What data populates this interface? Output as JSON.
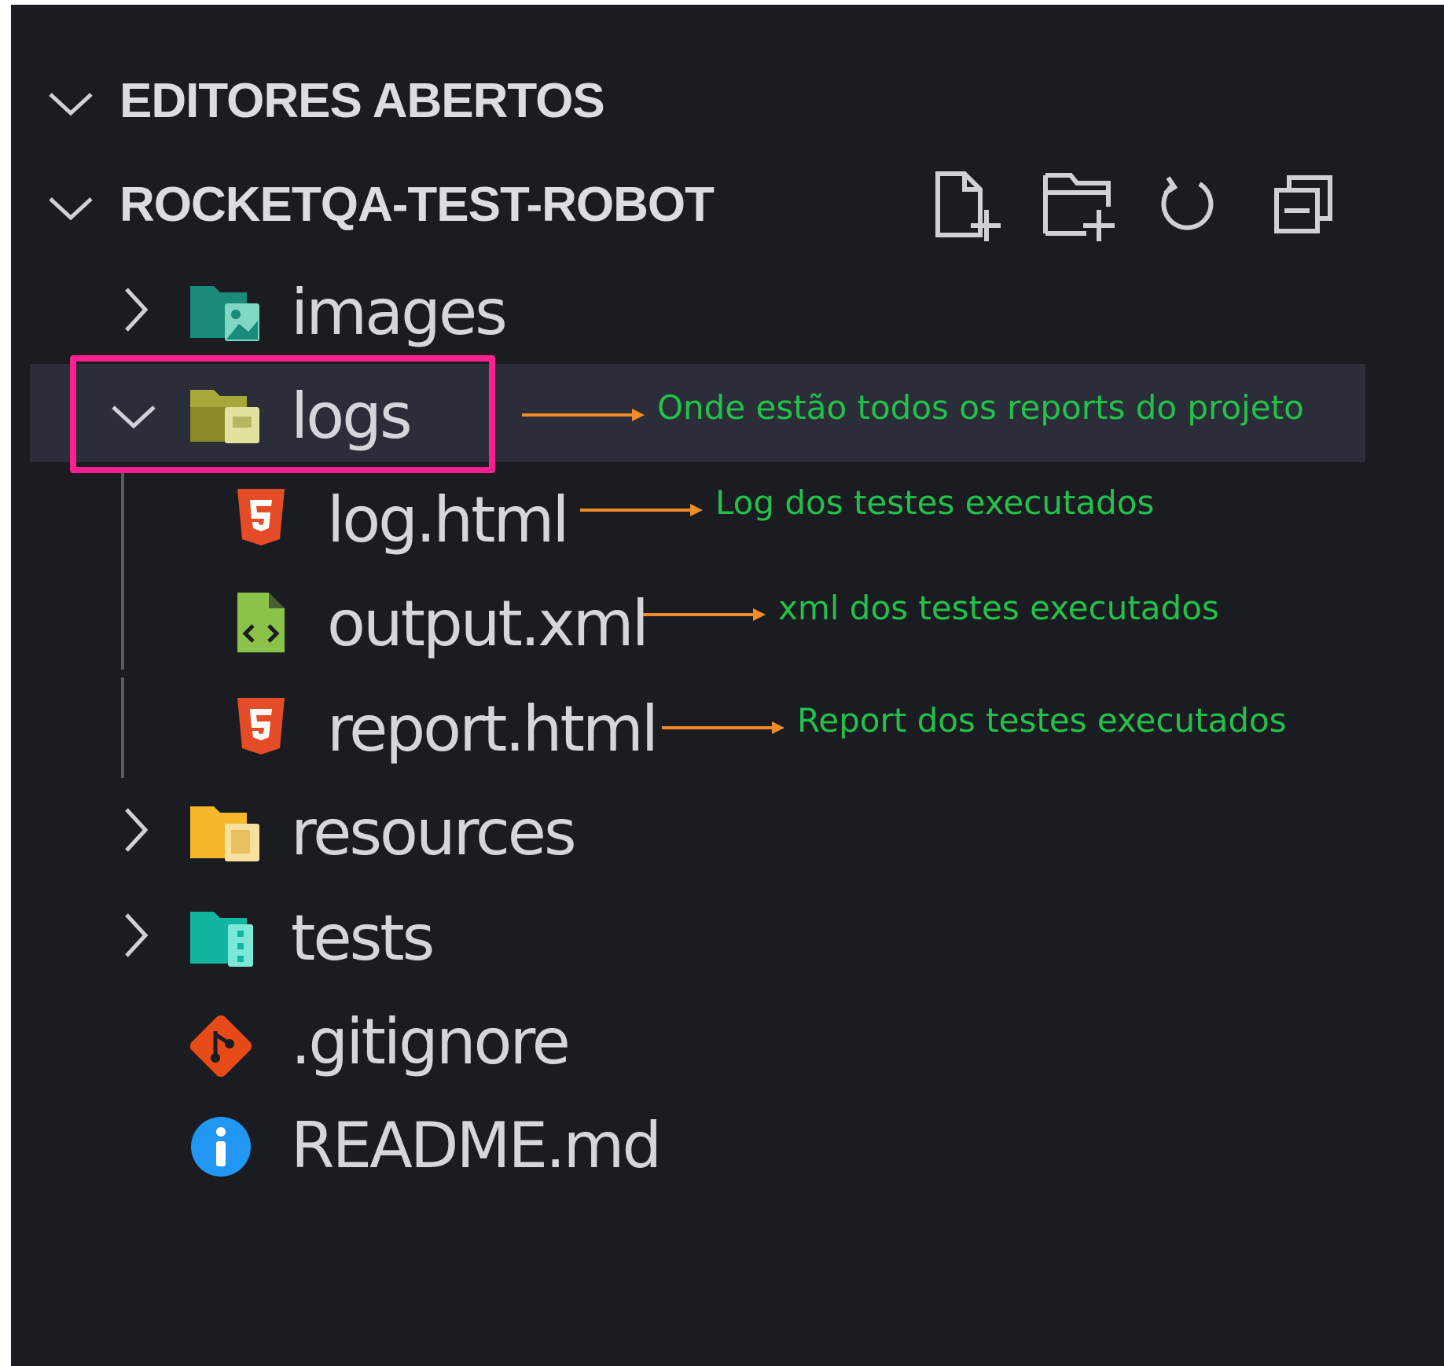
{
  "sections": {
    "open_editors": {
      "title": "EDITORES ABERTOS"
    },
    "project": {
      "title": "ROCKETQA-TEST-ROBOT"
    }
  },
  "toolbar": {
    "icons": [
      "new-file-icon",
      "new-folder-icon",
      "refresh-icon",
      "collapse-all-icon"
    ]
  },
  "tree": {
    "images": {
      "label": "images",
      "icon": "image-folder-icon",
      "expanded": false
    },
    "logs": {
      "label": "logs",
      "icon": "logs-folder-icon",
      "expanded": true,
      "selected": true
    },
    "log_html": {
      "label": "log.html",
      "icon": "html5-icon"
    },
    "output_xml": {
      "label": "output.xml",
      "icon": "xml-file-icon"
    },
    "report_html": {
      "label": "report.html",
      "icon": "html5-icon"
    },
    "resources": {
      "label": "resources",
      "icon": "resources-folder-icon",
      "expanded": false
    },
    "tests": {
      "label": "tests",
      "icon": "tests-folder-icon",
      "expanded": false
    },
    "gitignore": {
      "label": ".gitignore",
      "icon": "git-icon"
    },
    "readme": {
      "label": "README.md",
      "icon": "info-icon"
    }
  },
  "annotations": {
    "logs": "Onde estão todos os reports do projeto",
    "log_html": "Log dos testes executados",
    "output_xml": "xml dos testes executados",
    "report_html": "Report dos testes executados"
  },
  "colors": {
    "background": "#1b1c21",
    "selection": "#2b2e38",
    "highlight": "#ff1f8e",
    "annotation_text": "#22c24a",
    "arrow": "#f28c28",
    "html5": "#e34c26",
    "xml": "#8bc34a",
    "git": "#e64a19",
    "info": "#2196f3"
  }
}
